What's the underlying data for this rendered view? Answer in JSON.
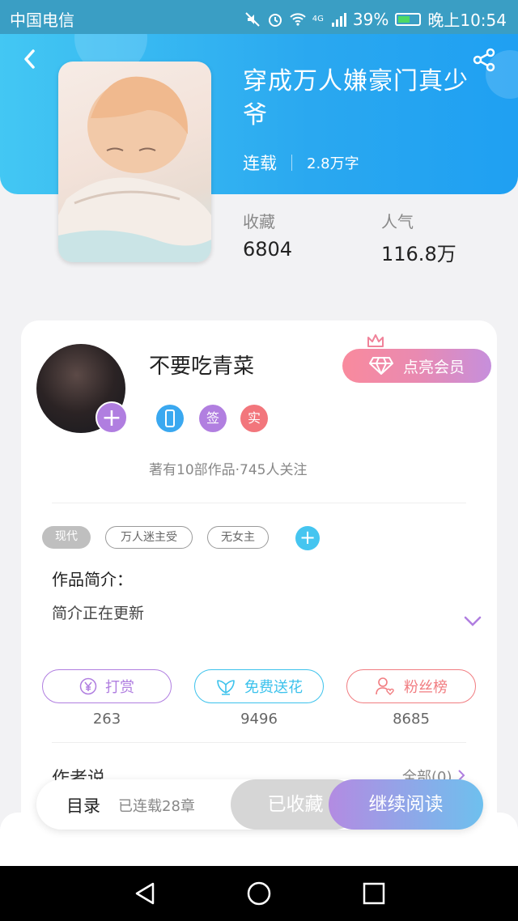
{
  "status_bar": {
    "carrier": "中国电信",
    "network": "4G",
    "battery": "39%",
    "time": "晚上10:54"
  },
  "book": {
    "title": "穿成万人嫌豪门真少爷",
    "status": "连载",
    "word_count": "2.8万字",
    "stats": [
      {
        "label": "收藏",
        "value": "6804"
      },
      {
        "label": "人气",
        "value": "116.8万"
      }
    ]
  },
  "author": {
    "name": "不要吃青菜",
    "vip_label": "点亮会员",
    "badges": [
      {
        "icon": "phone-badge-icon",
        "text": "",
        "color": "#3aa8f0"
      },
      {
        "icon": "sign-badge-icon",
        "text": "签",
        "color": "#b17fe0"
      },
      {
        "icon": "real-badge-icon",
        "text": "实",
        "color": "#f2767c"
      }
    ],
    "meta": "著有10部作品·745人关注"
  },
  "tags": [
    "现代",
    "万人迷主受",
    "无女主"
  ],
  "intro": {
    "title": "作品简介：",
    "text": "简介正在更新"
  },
  "actions": [
    {
      "label": "打赏",
      "count": "263",
      "color": "#b07ee0"
    },
    {
      "label": "免费送花",
      "count": "9496",
      "color": "#3cc2ec"
    },
    {
      "label": "粉丝榜",
      "count": "8685",
      "color": "#f17c80"
    }
  ],
  "author_says": {
    "title": "作者说",
    "all_link": "全部(0)"
  },
  "bottom_bar": {
    "toc": "目录",
    "chapters": "已连载28章",
    "favorited": "已收藏",
    "continue": "继续阅读"
  },
  "colors": {
    "header": "#2aa8f0",
    "accent_purple": "#b07ee0",
    "accent_blue": "#45c5f0"
  }
}
